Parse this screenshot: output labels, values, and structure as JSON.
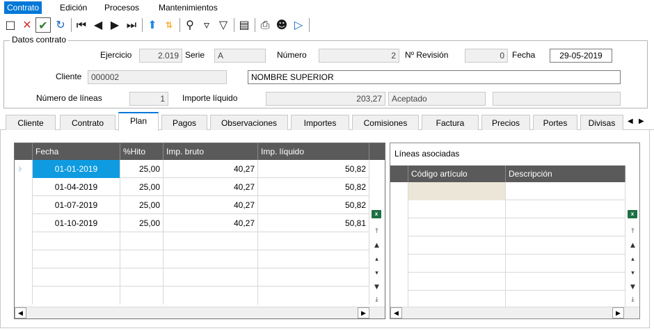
{
  "menu": {
    "items": [
      {
        "label": "Contrato"
      },
      {
        "label": "Edición"
      },
      {
        "label": "Procesos"
      },
      {
        "label": "Mantenimientos"
      }
    ]
  },
  "toolbar": {
    "icons": [
      "new-icon",
      "delete-icon",
      "confirm-icon",
      "undo-icon",
      "first-record-icon",
      "previous-record-icon",
      "next-record-icon",
      "last-record-icon",
      "sort-icon",
      "sort-az-icon",
      "search-icon",
      "filter-icon",
      "clear-filter-icon",
      "grid-view-icon",
      "print-icon",
      "user-icon",
      "run-icon"
    ],
    "colors": {
      "delete": "#d32f2f",
      "confirm": "#2e7d32",
      "undo": "#1565c0",
      "sort": "#1e88e5",
      "sort_az": "#f9a825"
    }
  },
  "header": {
    "title": "Datos contrato",
    "ejercicio_label": "Ejercicio",
    "ejercicio_value": "2.019",
    "serie_label": "Serie",
    "serie_value": "A",
    "numero_label": "Número",
    "numero_value": "2",
    "revision_label": "Nº Revisión",
    "revision_value": "0",
    "fecha_label": "Fecha",
    "fecha_value": "29-05-2019",
    "cliente_label": "Cliente",
    "cliente_code": "000002",
    "cliente_name": "NOMBRE SUPERIOR",
    "lineas_label": "Número de líneas",
    "lineas_value": "1",
    "importe_label": "Importe líquido",
    "importe_value": "203,27",
    "estado_value": "Aceptado",
    "extra_value": ""
  },
  "tabs": [
    {
      "label": "Cliente"
    },
    {
      "label": "Contrato"
    },
    {
      "label": "Plan",
      "active": true
    },
    {
      "label": "Pagos"
    },
    {
      "label": "Observaciones"
    },
    {
      "label": "Importes"
    },
    {
      "label": "Comisiones"
    },
    {
      "label": "Factura"
    },
    {
      "label": "Precios"
    },
    {
      "label": "Portes"
    },
    {
      "label": "Divisas"
    }
  ],
  "plan_grid": {
    "columns": [
      "Fecha",
      "%Hito",
      "Imp. bruto",
      "Imp. líquido"
    ],
    "rows": [
      {
        "fecha": "01-01-2019",
        "hito": "25,00",
        "bruto": "40,27",
        "liquido": "50,82"
      },
      {
        "fecha": "01-04-2019",
        "hito": "25,00",
        "bruto": "40,27",
        "liquido": "50,82"
      },
      {
        "fecha": "01-07-2019",
        "hito": "25,00",
        "bruto": "40,27",
        "liquido": "50,82"
      },
      {
        "fecha": "01-10-2019",
        "hito": "25,00",
        "bruto": "40,27",
        "liquido": "50,81"
      }
    ]
  },
  "lineas_grid": {
    "title": "Líneas asociadas",
    "columns": [
      "Código artículo",
      "Descripción"
    ]
  },
  "excel_label": "x"
}
